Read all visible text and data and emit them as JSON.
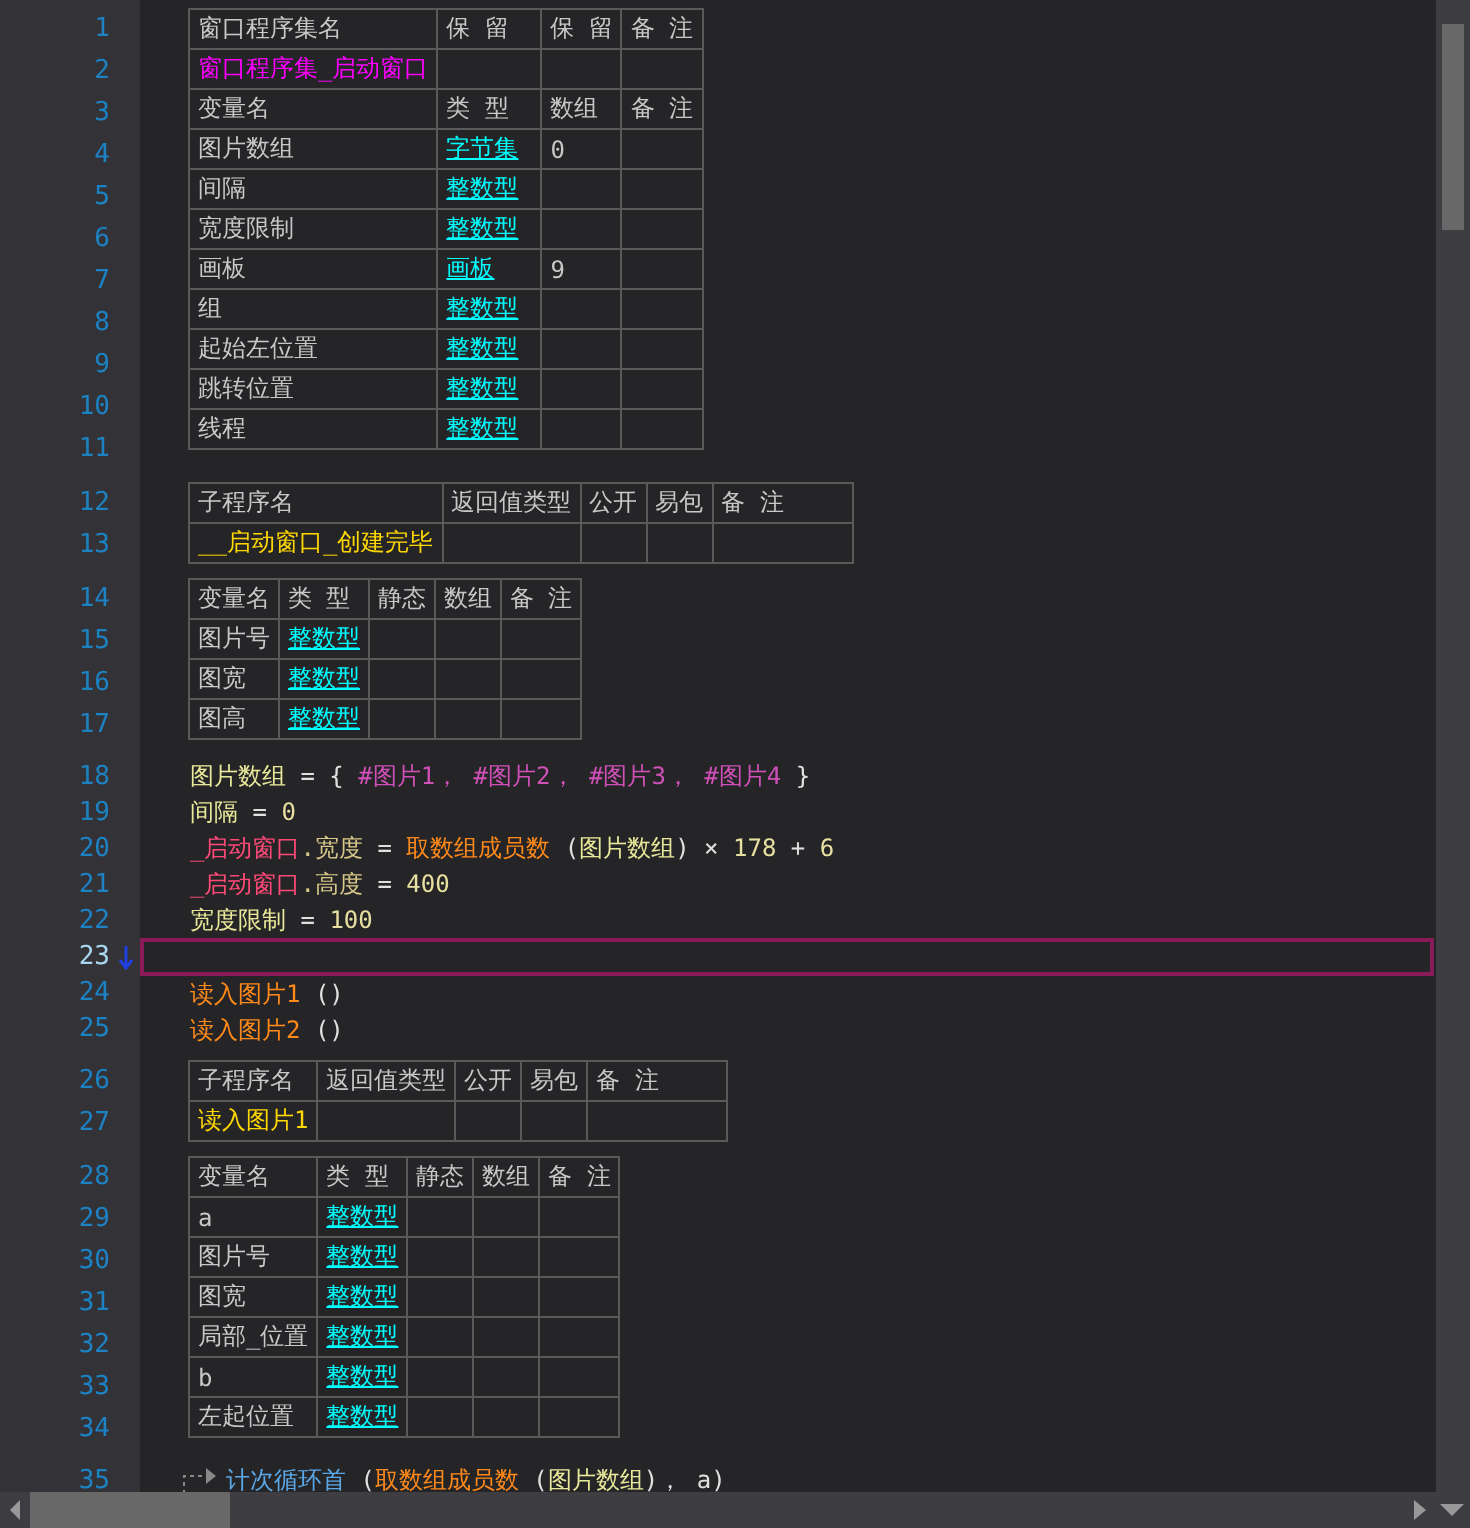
{
  "blocks": [
    {
      "kind": "table",
      "rows": [
        {
          "line": "1",
          "cells": [
            {
              "kind": "header",
              "text": "窗口程序集名"
            },
            {
              "kind": "header",
              "text": "保 留"
            },
            {
              "kind": "header",
              "text": "保 留"
            },
            {
              "kind": "header",
              "text": "备 注"
            }
          ]
        },
        {
          "line": "2",
          "cells": [
            {
              "kind": "assembly",
              "text": "窗口程序集_启动窗口"
            },
            {
              "kind": "empty"
            },
            {
              "kind": "empty"
            },
            {
              "kind": "empty"
            }
          ]
        },
        {
          "line": "3",
          "cells": [
            {
              "kind": "header",
              "text": "变量名"
            },
            {
              "kind": "header",
              "text": "类 型"
            },
            {
              "kind": "header",
              "text": "数组"
            },
            {
              "kind": "header",
              "text": "备 注"
            }
          ]
        },
        {
          "line": "4",
          "cells": [
            {
              "kind": "plain",
              "text": "图片数组"
            },
            {
              "kind": "type",
              "text": "字节集"
            },
            {
              "kind": "plain",
              "text": "0"
            },
            {
              "kind": "empty"
            }
          ]
        },
        {
          "line": "5",
          "cells": [
            {
              "kind": "plain",
              "text": "间隔"
            },
            {
              "kind": "type",
              "text": "整数型"
            },
            {
              "kind": "empty"
            },
            {
              "kind": "empty"
            }
          ]
        },
        {
          "line": "6",
          "cells": [
            {
              "kind": "plain",
              "text": "宽度限制"
            },
            {
              "kind": "type",
              "text": "整数型"
            },
            {
              "kind": "empty"
            },
            {
              "kind": "empty"
            }
          ]
        },
        {
          "line": "7",
          "cells": [
            {
              "kind": "plain",
              "text": "画板"
            },
            {
              "kind": "type",
              "text": "画板"
            },
            {
              "kind": "plain",
              "text": "9"
            },
            {
              "kind": "empty"
            }
          ]
        },
        {
          "line": "8",
          "cells": [
            {
              "kind": "plain",
              "text": "组"
            },
            {
              "kind": "type",
              "text": "整数型"
            },
            {
              "kind": "empty"
            },
            {
              "kind": "empty"
            }
          ]
        },
        {
          "line": "9",
          "cells": [
            {
              "kind": "plain",
              "text": "起始左位置"
            },
            {
              "kind": "type",
              "text": "整数型"
            },
            {
              "kind": "empty"
            },
            {
              "kind": "empty"
            }
          ]
        },
        {
          "line": "10",
          "cells": [
            {
              "kind": "plain",
              "text": "跳转位置"
            },
            {
              "kind": "type",
              "text": "整数型"
            },
            {
              "kind": "empty"
            },
            {
              "kind": "empty"
            }
          ]
        },
        {
          "line": "11",
          "cells": [
            {
              "kind": "plain",
              "text": "线程"
            },
            {
              "kind": "type",
              "text": "整数型"
            },
            {
              "kind": "empty"
            },
            {
              "kind": "empty"
            }
          ]
        }
      ]
    },
    {
      "kind": "table",
      "rows": [
        {
          "line": "12",
          "cells": [
            {
              "kind": "header",
              "text": "子程序名"
            },
            {
              "kind": "header",
              "text": "返回值类型"
            },
            {
              "kind": "header",
              "text": "公开"
            },
            {
              "kind": "header",
              "text": "易包"
            },
            {
              "kind": "header",
              "text": "备 注"
            }
          ]
        },
        {
          "line": "13",
          "cells": [
            {
              "kind": "sub",
              "text": "__启动窗口_创建完毕"
            },
            {
              "kind": "empty"
            },
            {
              "kind": "empty"
            },
            {
              "kind": "empty"
            },
            {
              "kind": "empty"
            }
          ]
        }
      ]
    },
    {
      "kind": "table",
      "rows": [
        {
          "line": "14",
          "cells": [
            {
              "kind": "header",
              "text": "变量名"
            },
            {
              "kind": "header",
              "text": "类 型"
            },
            {
              "kind": "header",
              "text": "静态"
            },
            {
              "kind": "header",
              "text": "数组"
            },
            {
              "kind": "header",
              "text": "备 注"
            }
          ]
        },
        {
          "line": "15",
          "cells": [
            {
              "kind": "plain",
              "text": "图片号"
            },
            {
              "kind": "type",
              "text": "整数型"
            },
            {
              "kind": "empty"
            },
            {
              "kind": "empty"
            },
            {
              "kind": "empty"
            }
          ]
        },
        {
          "line": "16",
          "cells": [
            {
              "kind": "plain",
              "text": "图宽"
            },
            {
              "kind": "type",
              "text": "整数型"
            },
            {
              "kind": "empty"
            },
            {
              "kind": "empty"
            },
            {
              "kind": "empty"
            }
          ]
        },
        {
          "line": "17",
          "cells": [
            {
              "kind": "plain",
              "text": "图高"
            },
            {
              "kind": "type",
              "text": "整数型"
            },
            {
              "kind": "empty"
            },
            {
              "kind": "empty"
            },
            {
              "kind": "empty"
            }
          ]
        }
      ]
    },
    {
      "kind": "code",
      "lines": [
        {
          "line": "18",
          "current": false,
          "tokens": [
            {
              "kind": "var",
              "text": "图片数组"
            },
            {
              "kind": "op",
              "text": " = { "
            },
            {
              "kind": "const",
              "text": "#图片1，"
            },
            {
              "kind": "const",
              "text": " #图片2，"
            },
            {
              "kind": "const",
              "text": " #图片3，"
            },
            {
              "kind": "const",
              "text": " #图片4"
            },
            {
              "kind": "op",
              "text": " }"
            }
          ]
        },
        {
          "line": "19",
          "current": false,
          "tokens": [
            {
              "kind": "var",
              "text": "间隔"
            },
            {
              "kind": "op",
              "text": " = "
            },
            {
              "kind": "num",
              "text": "0"
            }
          ]
        },
        {
          "line": "20",
          "current": false,
          "tokens": [
            {
              "kind": "obj",
              "text": "_启动窗口"
            },
            {
              "kind": "prop",
              "text": ".宽度"
            },
            {
              "kind": "op",
              "text": " = "
            },
            {
              "kind": "func",
              "text": "取数组成员数"
            },
            {
              "kind": "op",
              "text": " ("
            },
            {
              "kind": "var",
              "text": "图片数组"
            },
            {
              "kind": "op",
              "text": ") × "
            },
            {
              "kind": "num",
              "text": "178"
            },
            {
              "kind": "op",
              "text": " + "
            },
            {
              "kind": "num",
              "text": "6"
            }
          ]
        },
        {
          "line": "21",
          "current": false,
          "tokens": [
            {
              "kind": "obj",
              "text": "_启动窗口"
            },
            {
              "kind": "prop",
              "text": ".高度"
            },
            {
              "kind": "op",
              "text": " = "
            },
            {
              "kind": "num",
              "text": "400"
            }
          ]
        },
        {
          "line": "22",
          "current": false,
          "tokens": [
            {
              "kind": "var",
              "text": "宽度限制"
            },
            {
              "kind": "op",
              "text": " = "
            },
            {
              "kind": "num",
              "text": "100"
            }
          ]
        },
        {
          "line": "23",
          "current": true
        },
        {
          "line": "24",
          "current": false,
          "tokens": [
            {
              "kind": "func",
              "text": "读入图片1"
            },
            {
              "kind": "op",
              "text": " ()"
            }
          ]
        },
        {
          "line": "25",
          "current": false,
          "tokens": [
            {
              "kind": "func",
              "text": "读入图片2"
            },
            {
              "kind": "op",
              "text": " ()"
            }
          ]
        }
      ]
    },
    {
      "kind": "table",
      "rows": [
        {
          "line": "26",
          "cells": [
            {
              "kind": "header",
              "text": "子程序名"
            },
            {
              "kind": "header",
              "text": "返回值类型"
            },
            {
              "kind": "header",
              "text": "公开"
            },
            {
              "kind": "header",
              "text": "易包"
            },
            {
              "kind": "header",
              "text": "备 注"
            }
          ]
        },
        {
          "line": "27",
          "cells": [
            {
              "kind": "sub",
              "text": "读入图片1"
            },
            {
              "kind": "empty"
            },
            {
              "kind": "empty"
            },
            {
              "kind": "empty"
            },
            {
              "kind": "empty"
            }
          ]
        }
      ]
    },
    {
      "kind": "table",
      "rows": [
        {
          "line": "28",
          "cells": [
            {
              "kind": "header",
              "text": "变量名"
            },
            {
              "kind": "header",
              "text": "类 型"
            },
            {
              "kind": "header",
              "text": "静态"
            },
            {
              "kind": "header",
              "text": "数组"
            },
            {
              "kind": "header",
              "text": "备 注"
            }
          ]
        },
        {
          "line": "29",
          "cells": [
            {
              "kind": "plain",
              "text": "a"
            },
            {
              "kind": "type",
              "text": "整数型"
            },
            {
              "kind": "empty"
            },
            {
              "kind": "empty"
            },
            {
              "kind": "empty"
            }
          ]
        },
        {
          "line": "30",
          "cells": [
            {
              "kind": "plain",
              "text": "图片号"
            },
            {
              "kind": "type",
              "text": "整数型"
            },
            {
              "kind": "empty"
            },
            {
              "kind": "empty"
            },
            {
              "kind": "empty"
            }
          ]
        },
        {
          "line": "31",
          "cells": [
            {
              "kind": "plain",
              "text": "图宽"
            },
            {
              "kind": "type",
              "text": "整数型"
            },
            {
              "kind": "empty"
            },
            {
              "kind": "empty"
            },
            {
              "kind": "empty"
            }
          ]
        },
        {
          "line": "32",
          "cells": [
            {
              "kind": "plain",
              "text": "局部_位置"
            },
            {
              "kind": "type",
              "text": "整数型"
            },
            {
              "kind": "empty"
            },
            {
              "kind": "empty"
            },
            {
              "kind": "empty"
            }
          ]
        },
        {
          "line": "33",
          "cells": [
            {
              "kind": "plain",
              "text": "b"
            },
            {
              "kind": "type",
              "text": "整数型"
            },
            {
              "kind": "empty"
            },
            {
              "kind": "empty"
            },
            {
              "kind": "empty"
            }
          ]
        },
        {
          "line": "34",
          "cells": [
            {
              "kind": "plain",
              "text": "左起位置"
            },
            {
              "kind": "type",
              "text": "整数型"
            },
            {
              "kind": "empty"
            },
            {
              "kind": "empty"
            },
            {
              "kind": "empty"
            }
          ]
        }
      ]
    },
    {
      "kind": "code",
      "lines": [
        {
          "line": "35",
          "current": false,
          "tokens": [
            {
              "kind": "keyword",
              "text": "计次循环首"
            },
            {
              "kind": "op",
              "text": " ("
            },
            {
              "kind": "func",
              "text": "取数组成员数"
            },
            {
              "kind": "op",
              "text": " ("
            },
            {
              "kind": "var",
              "text": "图片数组"
            },
            {
              "kind": "op",
              "text": ")， a)"
            }
          ]
        }
      ]
    }
  ]
}
